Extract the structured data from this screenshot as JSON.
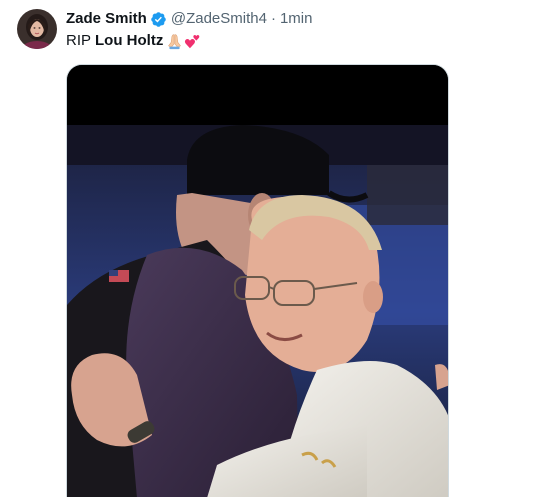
{
  "tweet": {
    "display_name": "Zade Smith",
    "verified": true,
    "handle": "@ZadeSmith4",
    "separator": "·",
    "timestamp": "1min",
    "text_prefix": "RIP",
    "text_name": "Lou Holtz",
    "emojis": [
      "folded-hands-icon",
      "two-hearts-icon"
    ]
  },
  "colors": {
    "verified_blue": "#1d9bf0",
    "secondary_text": "#536471",
    "primary_text": "#0f1419"
  }
}
